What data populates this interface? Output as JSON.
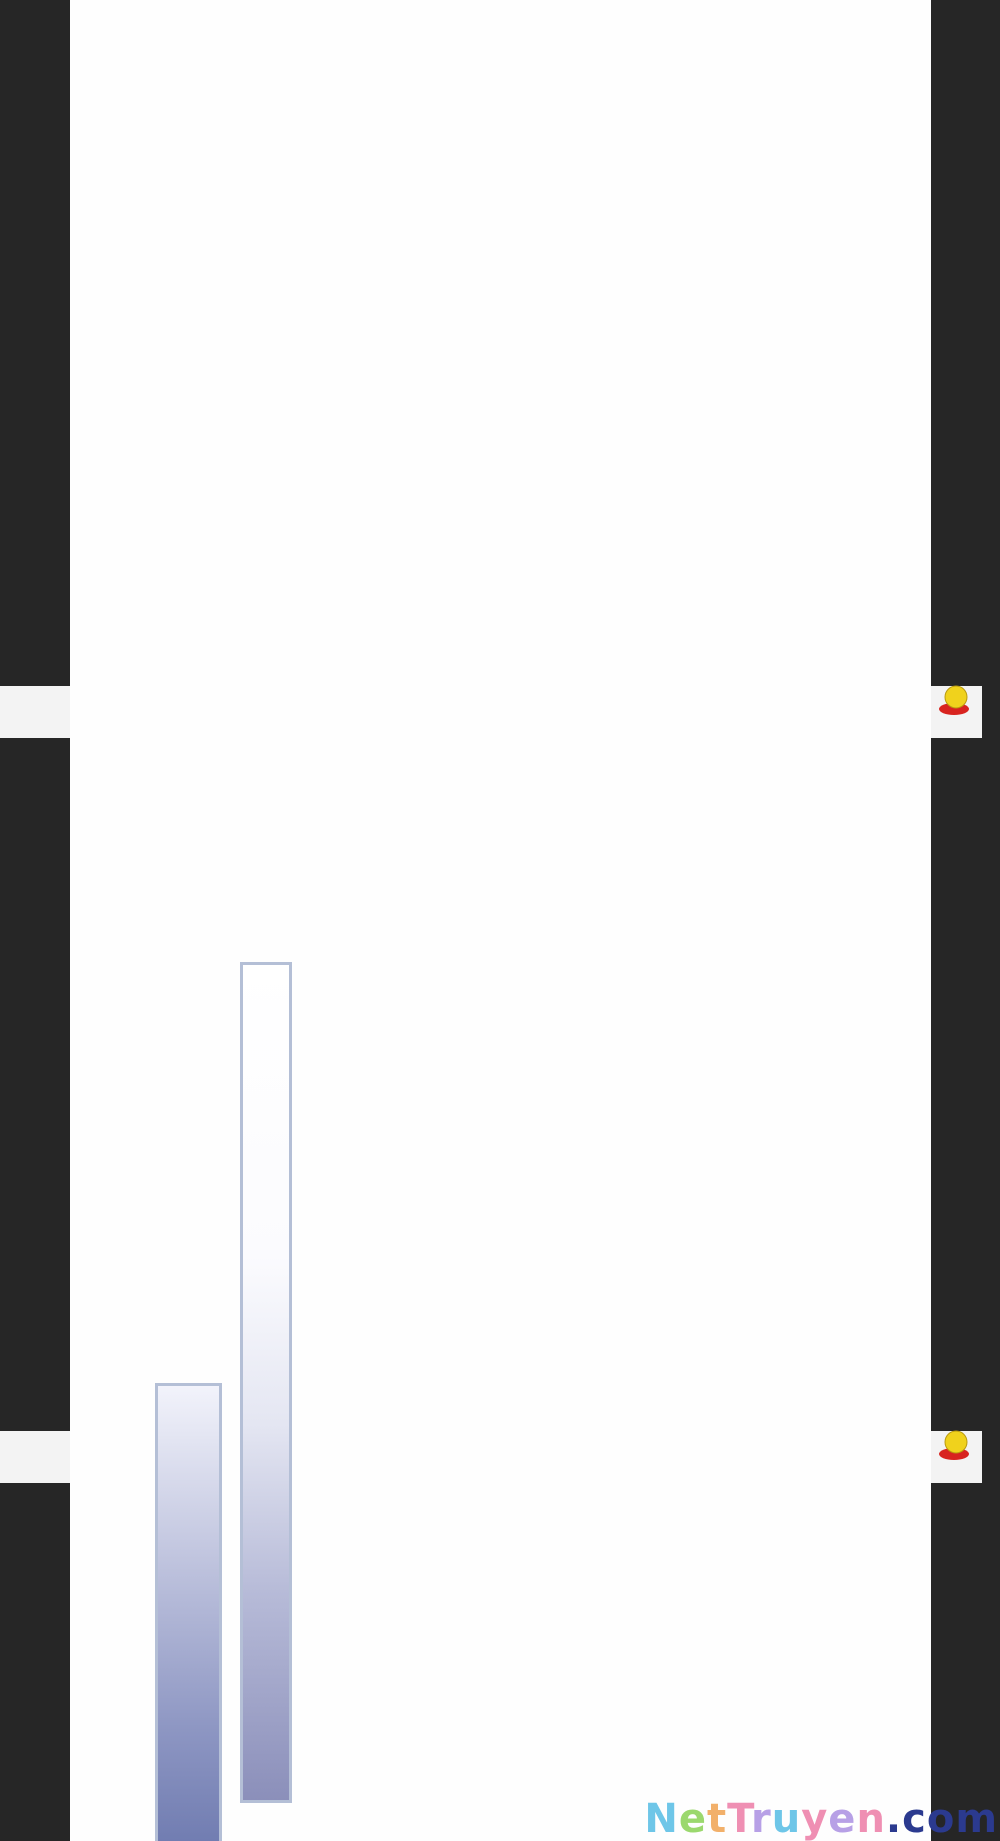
{
  "colors": {
    "outer_background": "#262626",
    "page_background": "#fefefe",
    "strip_background": "#f3f3f3",
    "bar_border": "#b4bfd6",
    "bar_fill_dark": "#6f7bb0"
  },
  "strips": [
    {
      "icon": "emoji-face-icon"
    },
    {
      "icon": "emoji-face-icon"
    }
  ],
  "watermark": {
    "text": "NetTruyen.com",
    "parts": [
      "N",
      "e",
      "t",
      "T",
      "r",
      "u",
      "y",
      "e",
      "n",
      ".",
      "com"
    ]
  }
}
